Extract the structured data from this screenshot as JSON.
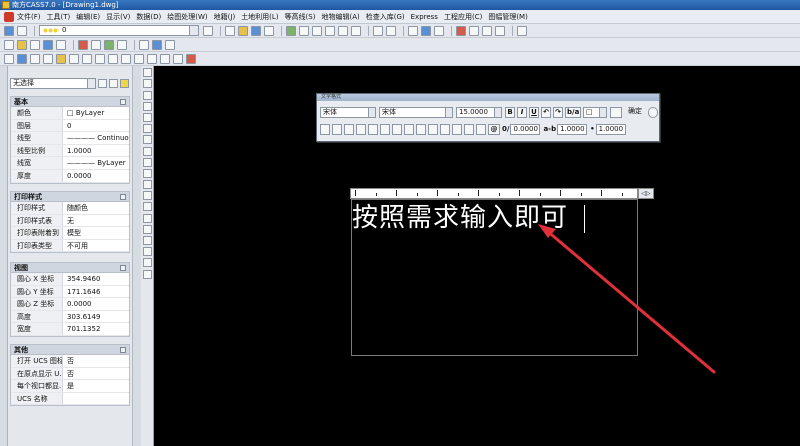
{
  "window": {
    "title": "南方CASS7.0 - [Drawing1.dwg]"
  },
  "menu": {
    "items": [
      "文件(F)",
      "工具(T)",
      "编辑(E)",
      "显示(V)",
      "数据(D)",
      "绘图处理(W)",
      "地籍(J)",
      "土地利用(L)",
      "等高线(S)",
      "地物编辑(A)",
      "检查入库(G)",
      "Express",
      "工程应用(C)",
      "图幅管理(M)"
    ]
  },
  "layer_bar": {
    "layer_value": "0"
  },
  "properties": {
    "selection_value": "无选择",
    "sections": [
      {
        "title": "基本",
        "rows": [
          {
            "key": "颜色",
            "value": "□ ByLayer"
          },
          {
            "key": "图层",
            "value": "0"
          },
          {
            "key": "线型",
            "value": "———— Continuo..."
          },
          {
            "key": "线型比例",
            "value": "1.0000"
          },
          {
            "key": "线宽",
            "value": "———— ByLayer"
          },
          {
            "key": "厚度",
            "value": "0.0000"
          }
        ]
      },
      {
        "title": "打印样式",
        "rows": [
          {
            "key": "打印样式",
            "value": "随颜色"
          },
          {
            "key": "打印样式表",
            "value": "无"
          },
          {
            "key": "打印表附着到",
            "value": "模型"
          },
          {
            "key": "打印表类型",
            "value": "不可用"
          }
        ]
      },
      {
        "title": "视图",
        "rows": [
          {
            "key": "圆心 X 坐标",
            "value": "354.9460"
          },
          {
            "key": "圆心 Y 坐标",
            "value": "171.1646"
          },
          {
            "key": "圆心 Z 坐标",
            "value": "0.0000"
          },
          {
            "key": "高度",
            "value": "303.6149"
          },
          {
            "key": "宽度",
            "value": "701.1352"
          }
        ]
      },
      {
        "title": "其他",
        "rows": [
          {
            "key": "打开 UCS 图标",
            "value": "否"
          },
          {
            "key": "在原点显示 U...",
            "value": "否"
          },
          {
            "key": "每个视口都显...",
            "value": "是"
          },
          {
            "key": "UCS 名称",
            "value": ""
          }
        ]
      }
    ]
  },
  "text_formatting": {
    "title": "文字格式",
    "style": "宋体",
    "font": "宋体",
    "height": "15.0000",
    "bold": "B",
    "italic": "I",
    "underline": "U",
    "undo": "↶",
    "redo": "↷",
    "stack": "b/a",
    "color": "□",
    "ok": "确定",
    "oblique": "0.0000",
    "tracking": "1.0000",
    "width_factor": "1.0000",
    "at": "@"
  },
  "editor": {
    "typed_text": "按照需求输入即可",
    "ruler_tail": "◁▷"
  },
  "colors": {
    "annotation_arrow": "#e0303a",
    "canvas": "#000000"
  }
}
